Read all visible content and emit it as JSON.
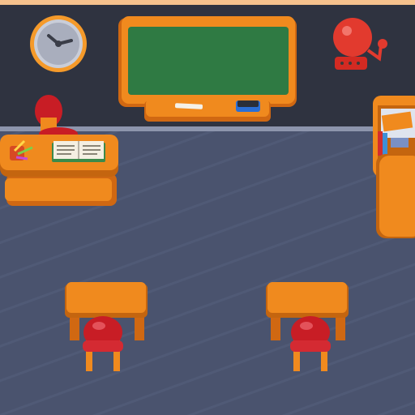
{
  "scene": {
    "title": "",
    "objects": {
      "wall_clock": "clock-icon",
      "chalkboard": "chalkboard",
      "school_bell": "bell-icon",
      "teacher_desk": "teacher-desk",
      "teacher_chair": "chair",
      "open_book": "book-icon",
      "pencils": "pencil-icon",
      "bookshelf": "bookshelf",
      "student_desk_left": "student-desk",
      "student_desk_right": "student-desk",
      "student_chair_left": "chair",
      "student_chair_right": "chair"
    },
    "colors": {
      "wall": "#2f3340",
      "floor": "#4a536e",
      "furniture_orange": "#f08a1e",
      "furniture_shadow": "#c4650f",
      "chair_red": "#cc1f2a",
      "board_green": "#2f7a43",
      "top_strip": "#f6c28d"
    }
  }
}
